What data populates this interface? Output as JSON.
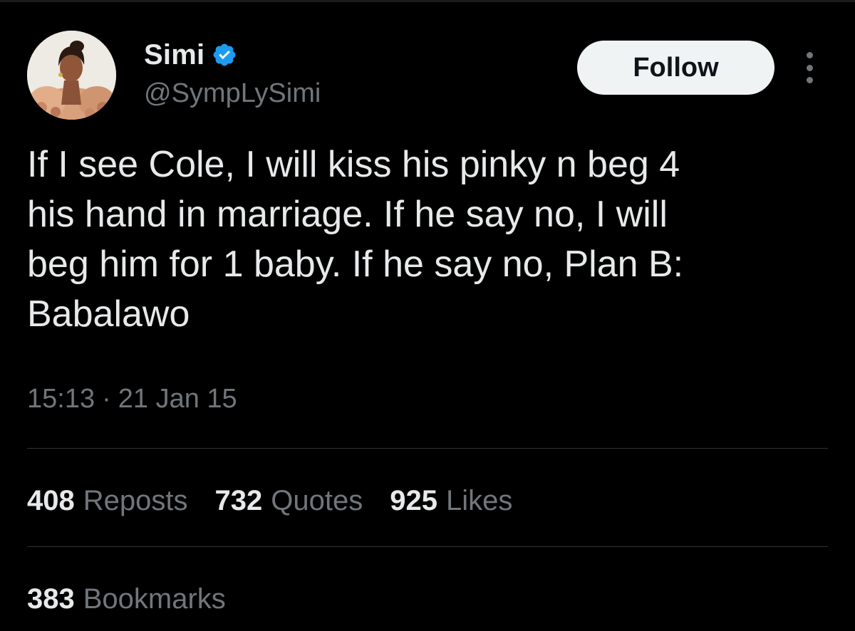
{
  "author": {
    "display_name": "Simi",
    "handle": "@SympLySimi",
    "verified": true,
    "avatar_icon": "profile-photo"
  },
  "follow_button": {
    "label": "Follow"
  },
  "more_menu": {
    "icon": "more-vertical-icon"
  },
  "tweet": {
    "text_lines": [
      "If I see Cole, I will kiss his pinky n beg 4",
      "his hand in marriage. If he say no, I will",
      "beg him for 1 baby. If he say no, Plan B:",
      "Babalawo"
    ],
    "time": "15:13",
    "separator": "·",
    "date": "21 Jan 15"
  },
  "stats": [
    {
      "count": "408",
      "label": "Reposts"
    },
    {
      "count": "732",
      "label": "Quotes"
    },
    {
      "count": "925",
      "label": "Likes"
    }
  ],
  "bookmarks": {
    "count": "383",
    "label": "Bookmarks"
  },
  "colors": {
    "background": "#000000",
    "primary_text": "#e7e9ea",
    "secondary_text": "#71767b",
    "verified_badge": "#1d9bf0",
    "follow_bg": "#eff3f4",
    "divider": "#2f3336"
  }
}
